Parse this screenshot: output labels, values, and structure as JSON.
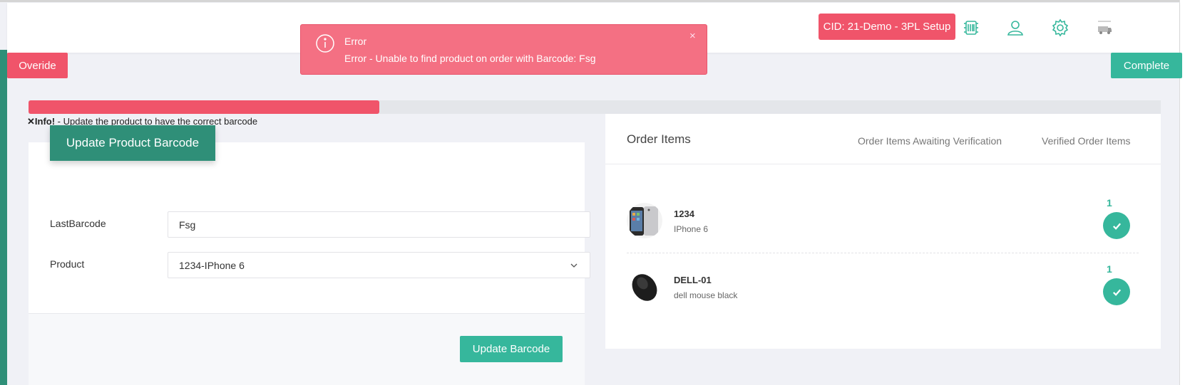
{
  "header": {
    "cid_badge": "CID: 21-Demo - 3PL Setup",
    "icons": [
      "barcode-scanner-icon",
      "user-icon",
      "gear-icon",
      "company-logo-icon"
    ]
  },
  "toast": {
    "title": "Error",
    "message": "Error - Unable to find product on order with Barcode: Fsg",
    "close": "×",
    "color": "#f47083"
  },
  "actions": {
    "override_label": "Overide",
    "complete_label": "Complete"
  },
  "progress": {
    "fraction": 0.31,
    "color": "#f0546a"
  },
  "info": {
    "icon": "✕",
    "label": "Info!",
    "text": " - Update the product to have the correct barcode"
  },
  "form": {
    "tab_title": "Update Product Barcode",
    "last_barcode_label": "LastBarcode",
    "last_barcode_value": "Fsg",
    "product_label": "Product",
    "product_value": "1234-IPhone 6",
    "submit_label": "Update Barcode"
  },
  "order_items": {
    "title": "Order Items",
    "tab_awaiting": "Order Items Awaiting Verification",
    "tab_verified": "Verified Order Items",
    "items": [
      {
        "sku": "1234",
        "name": "IPhone 6",
        "qty": "1",
        "image": "iphone-image",
        "verified": true
      },
      {
        "sku": "DELL-01",
        "name": "dell mouse black",
        "qty": "1",
        "image": "mouse-image",
        "verified": true
      }
    ]
  },
  "colors": {
    "accent_green": "#36b79c",
    "dark_green": "#2f8f78",
    "danger_red": "#f0546a"
  }
}
